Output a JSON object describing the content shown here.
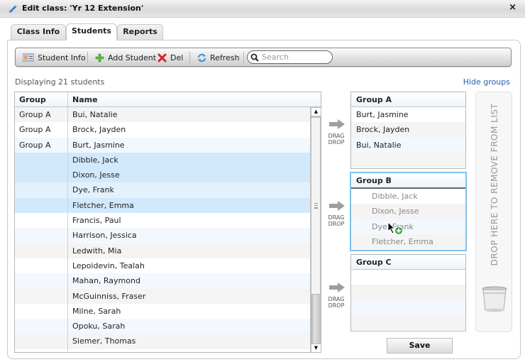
{
  "window": {
    "title": "Edit class: 'Yr 12 Extension'",
    "close_label": "×"
  },
  "tabs": [
    {
      "label": "Class Info",
      "active": false
    },
    {
      "label": "Students",
      "active": true
    },
    {
      "label": "Reports",
      "active": false
    }
  ],
  "toolbar": {
    "student_info": "Student Info",
    "add_student": "Add Student",
    "del": "Del",
    "refresh": "Refresh",
    "search_placeholder": "Search",
    "search_value": ""
  },
  "status": {
    "count_text": "Displaying 21 students",
    "hide_groups": "Hide groups"
  },
  "grid": {
    "columns": [
      "Group",
      "Name"
    ],
    "rows": [
      {
        "group": "Group A",
        "name": "Bui, Natalie"
      },
      {
        "group": "Group A",
        "name": "Brock, Jayden"
      },
      {
        "group": "Group A",
        "name": "Burt, Jasmine"
      },
      {
        "group": "",
        "name": "Dibble, Jack",
        "selected": true
      },
      {
        "group": "",
        "name": "Dixon, Jesse",
        "selected": true
      },
      {
        "group": "",
        "name": "Dye, Frank",
        "selected": true
      },
      {
        "group": "",
        "name": "Fletcher, Emma",
        "selected": true
      },
      {
        "group": "",
        "name": "Francis, Paul"
      },
      {
        "group": "",
        "name": "Harrison, Jessica"
      },
      {
        "group": "",
        "name": "Ledwith, Mia"
      },
      {
        "group": "",
        "name": "Lepoidevin, Tealah"
      },
      {
        "group": "",
        "name": "Mahan, Raymond"
      },
      {
        "group": "",
        "name": "McGuinniss, Fraser"
      },
      {
        "group": "",
        "name": "Milne, Sarah"
      },
      {
        "group": "",
        "name": "Opoku, Sarah"
      },
      {
        "group": "",
        "name": "Siemer, Thomas"
      }
    ]
  },
  "drag_drop": {
    "line1": "DRAG",
    "line2": "DROP"
  },
  "groups": [
    {
      "name": "Group A",
      "members": [
        "Burt, Jasmine",
        "Brock, Jayden",
        "Bui, Natalie"
      ]
    },
    {
      "name": "Group B",
      "members": [
        "Dibble, Jack",
        "Dixon, Jesse",
        "Dye, Frank",
        "Fletcher, Emma"
      ],
      "drop_target_active": true
    },
    {
      "name": "Group C",
      "members": []
    }
  ],
  "trash": {
    "label": "DROP HERE TO REMOVE FROM LIST"
  },
  "save_label": "Save",
  "colors": {
    "accent_link": "#1f5fae",
    "selected_row": "#d2e9fb",
    "drop_highlight": "#7ec0ef"
  }
}
